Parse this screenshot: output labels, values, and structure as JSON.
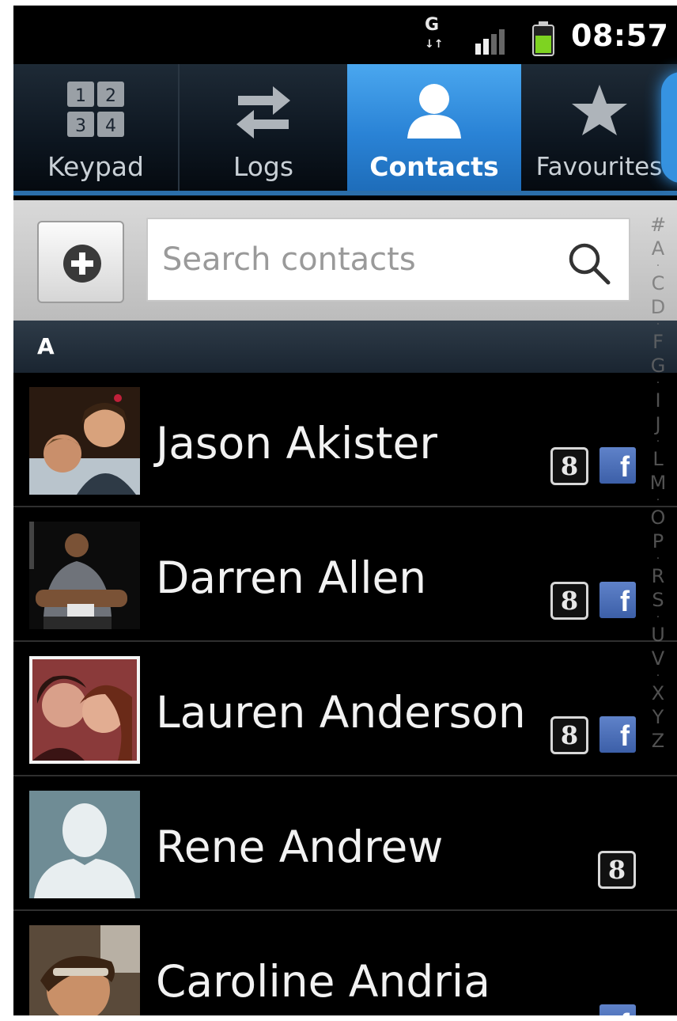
{
  "status_bar": {
    "network_label": "G",
    "time": "08:57"
  },
  "tabs": [
    {
      "id": "keypad",
      "label": "Keypad",
      "icon": "keypad-icon",
      "selected": false
    },
    {
      "id": "logs",
      "label": "Logs",
      "icon": "swap-arrows-icon",
      "selected": false
    },
    {
      "id": "contacts",
      "label": "Contacts",
      "icon": "person-icon",
      "selected": true
    },
    {
      "id": "favourites",
      "label": "Favourites",
      "icon": "star-icon",
      "selected": false
    }
  ],
  "keypad_icon_digits": [
    "1",
    "2",
    "3",
    "4"
  ],
  "search": {
    "placeholder": "Search contacts"
  },
  "section": {
    "letter": "A"
  },
  "contacts": [
    {
      "name": "Jason Akister",
      "badges": [
        "google",
        "facebook"
      ]
    },
    {
      "name": "Darren Allen",
      "badges": [
        "google",
        "facebook"
      ]
    },
    {
      "name": "Lauren Anderson",
      "badges": [
        "google",
        "facebook"
      ]
    },
    {
      "name": "Rene Andrew",
      "badges": [
        "google"
      ]
    },
    {
      "name": "Caroline Andria",
      "badges": [
        "facebook"
      ]
    }
  ],
  "badge_labels": {
    "google": "8",
    "facebook": "f"
  },
  "alphabet_index": [
    "#",
    "A",
    "C",
    "D",
    "F",
    "G",
    "I",
    "J",
    "L",
    "M",
    "O",
    "P",
    "R",
    "S",
    "U",
    "V",
    "X",
    "Y",
    "Z"
  ],
  "colors": {
    "selected_tab": "#2a83d6",
    "facebook_blue": "#3c5fa8",
    "battery_green": "#7ed321"
  }
}
